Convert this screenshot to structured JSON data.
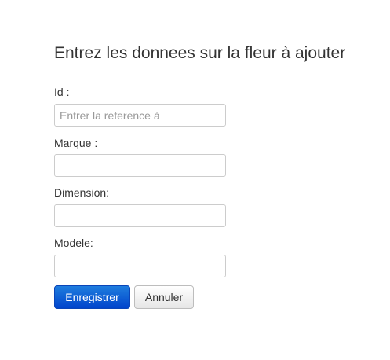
{
  "form": {
    "title": "Entrez les donnees sur la fleur à ajouter",
    "fields": [
      {
        "label": "Id :",
        "value": "",
        "placeholder": "Entrer la reference à"
      },
      {
        "label": "Marque :",
        "value": "",
        "placeholder": ""
      },
      {
        "label": "Dimension:",
        "value": "",
        "placeholder": ""
      },
      {
        "label": "Modele:",
        "value": "",
        "placeholder": ""
      }
    ],
    "buttons": {
      "save_label": "Enregistrer",
      "cancel_label": "Annuler"
    }
  },
  "colors": {
    "primary": "#0055cc",
    "text": "#333333",
    "border": "#cccccc",
    "placeholder": "#999999"
  }
}
